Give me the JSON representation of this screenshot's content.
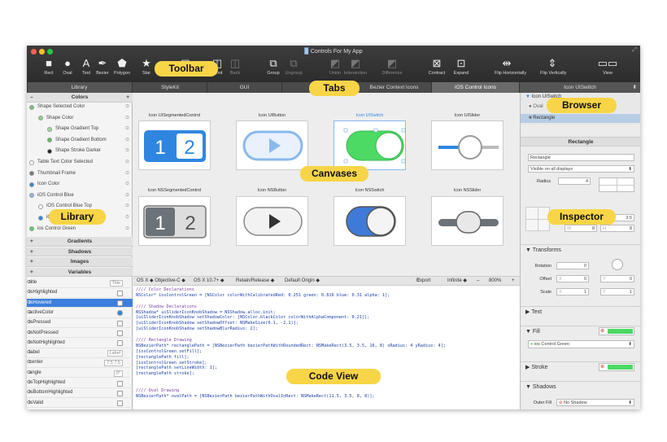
{
  "window": {
    "title": "Controls For My App"
  },
  "toolbar": {
    "tools": [
      {
        "label": "Rect",
        "icon": "rect-icon",
        "glyph": "■",
        "dim": false
      },
      {
        "label": "Oval",
        "icon": "oval-icon",
        "glyph": "●",
        "dim": false
      },
      {
        "label": "Text",
        "icon": "text-icon",
        "glyph": "A",
        "dim": false
      },
      {
        "label": "Bezier",
        "icon": "bezier-icon",
        "glyph": "✒",
        "dim": false
      },
      {
        "label": "Polygon",
        "icon": "polygon-icon",
        "glyph": "⬟",
        "dim": false
      },
      {
        "label": "Star",
        "icon": "star-icon",
        "glyph": "★",
        "dim": false
      },
      {
        "label": "Frame",
        "icon": "frame-icon",
        "glyph": "▢",
        "dim": false
      },
      {
        "label": "Front",
        "icon": "front-icon",
        "glyph": "◫",
        "dim": false
      },
      {
        "label": "Back",
        "icon": "back-icon",
        "glyph": "◫",
        "dim": true
      },
      {
        "label": "Group",
        "icon": "group-icon",
        "glyph": "⧉",
        "dim": false
      },
      {
        "label": "Ungroup",
        "icon": "ungroup-icon",
        "glyph": "⧉",
        "dim": true
      },
      {
        "label": "Union",
        "icon": "union-icon",
        "glyph": "◩",
        "dim": true
      },
      {
        "label": "Intersection",
        "icon": "intersection-icon",
        "glyph": "◩",
        "dim": true
      },
      {
        "label": "Difference",
        "icon": "difference-icon",
        "glyph": "◩",
        "dim": true
      },
      {
        "label": "Contract",
        "icon": "contract-icon",
        "glyph": "⊠",
        "dim": false
      },
      {
        "label": "Expand",
        "icon": "expand-icon",
        "glyph": "⊡",
        "dim": false
      },
      {
        "label": "Flip Horizontally",
        "icon": "flip-horizontal-icon",
        "glyph": "⇹",
        "dim": false
      },
      {
        "label": "Flip Vertically",
        "icon": "flip-vertical-icon",
        "glyph": "⇕",
        "dim": false
      },
      {
        "label": "View",
        "icon": "view-icon",
        "glyph": "▭▭",
        "dim": false
      }
    ]
  },
  "tabs": {
    "library": "Library",
    "items": [
      "StyleKit",
      "GUI",
      "Toolbar",
      "Bezier Context Icons",
      "iOS Control Icons"
    ],
    "active": 4,
    "inspector": "Icon UISwitch"
  },
  "library": {
    "colors_header": "Colors",
    "colors": [
      {
        "name": "Shape Selected Color",
        "color": "#6fc76f",
        "indent": 0
      },
      {
        "name": "Shape Color",
        "color": "#8fd18f",
        "indent": 1
      },
      {
        "name": "Shape Gradient Top",
        "color": "#9fd89f",
        "indent": 2
      },
      {
        "name": "Shape Gradient Bottom",
        "color": "#5fb85f",
        "indent": 2
      },
      {
        "name": "Shape Stroke Darker",
        "color": "#222222",
        "indent": 2
      },
      {
        "name": "Table Text Color Selected",
        "color": "#ffffff",
        "indent": 0
      },
      {
        "name": "Thumbnail Frame",
        "color": "#777777",
        "indent": 0
      },
      {
        "name": "Icon Color",
        "color": "#2f86e0",
        "indent": 0
      },
      {
        "name": "iOS Control Blue",
        "color": "#8ab9ec",
        "indent": 0
      },
      {
        "name": "iOS Control Blue Top",
        "color": "#ffffff",
        "indent": 1
      },
      {
        "name": "iOS Control Blue Bottom",
        "color": "#2f86e0",
        "indent": 1
      },
      {
        "name": "ios Control Green",
        "color": "#4cd964",
        "indent": 0
      }
    ],
    "sections": [
      "Gradients",
      "Shadows",
      "Images",
      "Variables"
    ],
    "variables": [
      {
        "name": "title",
        "value": "Title",
        "type": "text"
      },
      {
        "name": "isHighlighted",
        "value": "",
        "type": "check"
      },
      {
        "name": "isHovered",
        "value": "",
        "type": "check",
        "selected": true
      },
      {
        "name": "activeColor",
        "value": "",
        "type": "color"
      },
      {
        "name": "isPressed",
        "value": "",
        "type": "check"
      },
      {
        "name": "isNotPressed",
        "value": "",
        "type": "check"
      },
      {
        "name": "isNotHighlighted",
        "value": "",
        "type": "check"
      },
      {
        "name": "label",
        "value": "Label",
        "type": "text"
      },
      {
        "name": "center",
        "value": "7.5   7.5",
        "type": "text"
      },
      {
        "name": "angle",
        "value": "0°",
        "type": "text"
      },
      {
        "name": "isTopHighlighted",
        "value": "",
        "type": "check"
      },
      {
        "name": "isBottomHighlighted",
        "value": "",
        "type": "check"
      },
      {
        "name": "isValid",
        "value": "",
        "type": "check"
      }
    ]
  },
  "canvases": {
    "row1": [
      "Icon UISegmentedControl",
      "Icon UIButton",
      "Icon UISwitch",
      "Icon UISlider"
    ],
    "row2": [
      "Icon NSSegmentedControl",
      "Icon NSButton",
      "Icon NSSwitch",
      "Icon NSSlider"
    ],
    "seg_a": "1",
    "seg_b": "2"
  },
  "codebar": {
    "language": "OS X ◆ Objective-C ◆",
    "target": "OS X 10.7+ ◆",
    "memory": "Retain/Release ◆",
    "origin": "Default Origin ◆",
    "export": "Export",
    "infinite": "Infinite ◆",
    "zoom": "800%",
    "minus": "–",
    "plus": "+"
  },
  "code": [
    {
      "t": "//// Color Declarations",
      "c": "comment"
    },
    {
      "t": "NSColor* iosControlGreen = [NSColor colorWithCalibratedRed: 0.251 green: 0.816 blue: 0.31 alpha: 1];",
      "c": "code"
    },
    {
      "t": "",
      "c": "code"
    },
    {
      "t": "//// Shadow Declarations",
      "c": "comment"
    },
    {
      "t": "NSShadow* uiSliderIconKnobShadow = NSShadow.alloc.init;",
      "c": "code"
    },
    {
      "t": "[uiSliderIconKnobShadow setShadowColor: [NSColor.blackColor colorWithAlphaComponent: 0.21]];",
      "c": "code"
    },
    {
      "t": "[uiSliderIconKnobShadow setShadowOffset: NSMakeSize(0.1, -2.1)];",
      "c": "code"
    },
    {
      "t": "[uiSliderIconKnobShadow setShadowBlurRadius: 2];",
      "c": "code"
    },
    {
      "t": "",
      "c": "code"
    },
    {
      "t": "//// Rectangle Drawing",
      "c": "comment"
    },
    {
      "t": "NSBezierPath* rectanglePath = [NSBezierPath bezierPathWithRoundedRect: NSMakeRect(3.5, 3.5, 16, 8) xRadius: 4 yRadius: 4];",
      "c": "code"
    },
    {
      "t": "[iosControlGreen setFill];",
      "c": "code"
    },
    {
      "t": "[rectanglePath fill];",
      "c": "code"
    },
    {
      "t": "[iosControlGreen setStroke];",
      "c": "code"
    },
    {
      "t": "[rectanglePath setLineWidth: 1];",
      "c": "code"
    },
    {
      "t": "[rectanglePath stroke];",
      "c": "code"
    },
    {
      "t": "",
      "c": "code"
    },
    {
      "t": "",
      "c": "code"
    },
    {
      "t": "//// Oval Drawing",
      "c": "comment"
    },
    {
      "t": "NSBezierPath* ovalPath = [NSBezierPath bezierPathWithOvalInRect: NSMakeRect(11.5, 3.5, 8, 8)];",
      "c": "code"
    }
  ],
  "browser": {
    "root": "Icon UISwitch",
    "items": [
      "Oval",
      "Rectangle"
    ],
    "selected": "Rectangle"
  },
  "inspector": {
    "header": "Rectangle",
    "name": "Rectangle",
    "visibility": "Visible on all displays",
    "radius_label": "Radius",
    "radius": "4",
    "x_label": "X",
    "x": "3.5",
    "w_label": "W",
    "w": "8",
    "h_label": "H",
    "h": "8",
    "transforms": "Transforms",
    "rotation_label": "Rotation",
    "rotation": "0",
    "offset_label": "Offset",
    "offset_x": "0",
    "offset_y": "0",
    "scale_label": "Scale",
    "scale_x": "1",
    "scale_y": "1",
    "x_axis": "X",
    "y_axis": "Y",
    "text": "Text",
    "fill": "Fill",
    "fill_color_name": "ios Control Green",
    "stroke": "Stroke",
    "shadows": "Shadows",
    "outer_fill_label": "Outer Fill",
    "outer_fill": "No Shadow"
  },
  "callouts": {
    "toolbar": "Toolbar",
    "tabs": "Tabs",
    "browser": "Browser",
    "canvases": "Canvases",
    "library": "Library",
    "inspector": "Inspector",
    "codeview": "Code View"
  },
  "colors": {
    "accent_blue": "#2f86e0",
    "ios_green": "#4cd964",
    "callout": "#f7d547",
    "selection": "#3d7fdc"
  }
}
